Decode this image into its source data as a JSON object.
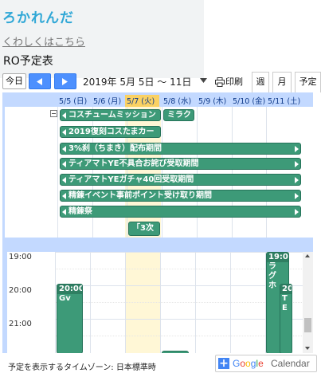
{
  "site": {
    "title": "ろかれんだ",
    "details_link": "くわしくはこちら"
  },
  "calendar_title": "RO予定表",
  "toolbar": {
    "today_label": "今日",
    "date_range": "2019年 5月 5日 ～ 11日",
    "print_label": "印刷",
    "view_tabs": [
      "週",
      "月",
      "予定"
    ]
  },
  "day_headers": [
    "5/5 (日)",
    "5/6 (月)",
    "5/7 (火)",
    "5/8 (水)",
    "5/9 (木)",
    "5/10 (金)",
    "5/11 (土)"
  ],
  "today_index": 2,
  "allday_events": [
    {
      "title": "コスチュームミッション",
      "cont_left": true,
      "cont_right": false
    },
    {
      "title": "ミラク",
      "cont_left": false,
      "cont_right": false
    },
    {
      "title": "2019復刻コスたまカー",
      "cont_left": true,
      "cont_right": false
    },
    {
      "title": "3%刹（ちまき）配布期間",
      "cont_left": true,
      "cont_right": true
    },
    {
      "title": "ティアマトYE不具合お詫び受取期間",
      "cont_left": true,
      "cont_right": true
    },
    {
      "title": "ティアマトYEガチャ40回受取期間",
      "cont_left": true,
      "cont_right": true
    },
    {
      "title": "精錬イベント事前ポイント受け取り期間",
      "cont_left": true,
      "cont_right": true
    },
    {
      "title": "精錬祭",
      "cont_left": true,
      "cont_right": true
    },
    {
      "title": "「3次",
      "cont_left": false,
      "cont_right": false
    }
  ],
  "hours": [
    "19:00",
    "20:00",
    "21:00"
  ],
  "timed_events": [
    {
      "time": "20:00",
      "title": "Gv"
    },
    {
      "time": "19:00",
      "title": "ラグホ"
    },
    {
      "time": "20",
      "title": "TE"
    }
  ],
  "footer": {
    "timezone_text": "予定を表示するタイムゾーン: 日本標準時",
    "google_text": "Google",
    "calendar_text": "Calendar",
    "plus_text": "+"
  },
  "colors": {
    "event_green": "#3d9a78",
    "grid_blue": "#c3d9ff",
    "today_yellow": "#fad163",
    "title_blue": "#2fa7d6",
    "nav_blue": "#4d90fe"
  },
  "icons": [
    "prev-arrow-icon",
    "next-arrow-icon",
    "dropdown-arrow-icon",
    "printer-icon",
    "collapse-icon",
    "google-plus-icon"
  ]
}
